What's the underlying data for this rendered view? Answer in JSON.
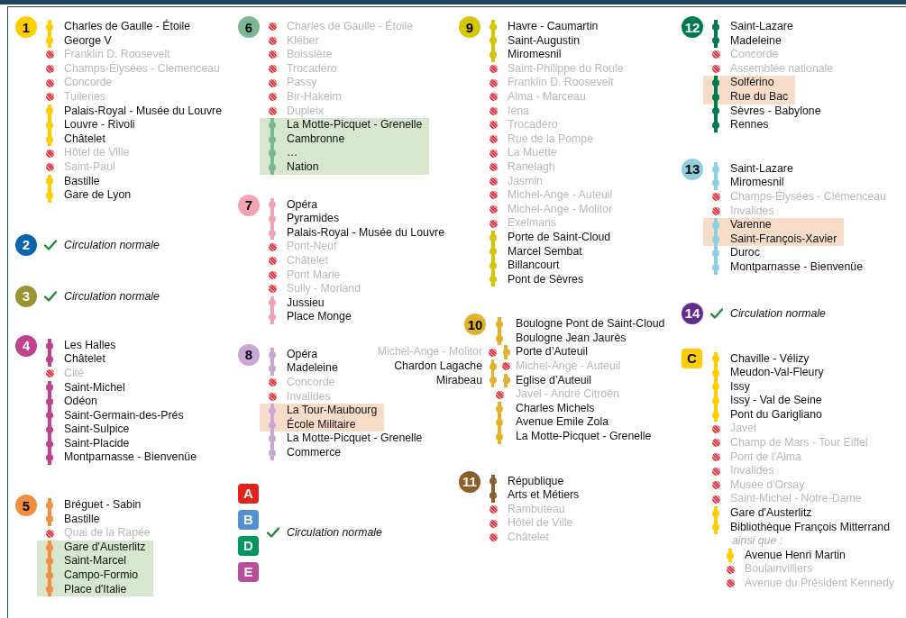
{
  "columns": [
    {
      "lines": [
        {
          "kind": "stations",
          "badge": {
            "label": "1",
            "color": "#ffcd00",
            "kind": "circle"
          },
          "stations": [
            {
              "name": "Charles de Gaulle - Étoile",
              "closed": false,
              "highlighted": false
            },
            {
              "name": "George V",
              "closed": false,
              "highlighted": false
            },
            {
              "name": "Franklin D. Roosevelt",
              "closed": true,
              "highlighted": false
            },
            {
              "name": "Champs-Élysées - Clemenceau",
              "closed": true,
              "highlighted": false
            },
            {
              "name": "Concorde",
              "closed": true,
              "highlighted": false
            },
            {
              "name": "Tuileries",
              "closed": true,
              "highlighted": false
            },
            {
              "name": "Palais-Royal - Musée du Louvre",
              "closed": false,
              "highlighted": false
            },
            {
              "name": "Louvre - Rivoli",
              "closed": false,
              "highlighted": false
            },
            {
              "name": "Châtelet",
              "closed": false,
              "highlighted": false
            },
            {
              "name": "Hôtel de Ville",
              "closed": true,
              "highlighted": false
            },
            {
              "name": "Saint-Paul",
              "closed": true,
              "highlighted": false
            },
            {
              "name": "Bastille",
              "closed": false,
              "highlighted": false
            },
            {
              "name": "Gare de Lyon",
              "closed": false,
              "highlighted": false
            }
          ]
        },
        {
          "kind": "status",
          "badge": {
            "label": "2",
            "color": "#0a64b0",
            "kind": "circle"
          },
          "status": "Circulation normale"
        },
        {
          "kind": "status",
          "badge": {
            "label": "3",
            "color": "#9a9331",
            "kind": "circle"
          },
          "status": "Circulation normale"
        },
        {
          "kind": "stations",
          "badge": {
            "label": "4",
            "color": "#c0428f",
            "kind": "circle"
          },
          "stations": [
            {
              "name": "Les Halles",
              "closed": false,
              "highlighted": false
            },
            {
              "name": "Châtelet",
              "closed": false,
              "highlighted": false
            },
            {
              "name": "Cité",
              "closed": true,
              "highlighted": false
            },
            {
              "name": "Saint-Michel",
              "closed": false,
              "highlighted": false
            },
            {
              "name": "Odéon",
              "closed": false,
              "highlighted": false
            },
            {
              "name": "Saint-Germain-des-Prés",
              "closed": false,
              "highlighted": false
            },
            {
              "name": "Saint-Sulpice",
              "closed": false,
              "highlighted": false
            },
            {
              "name": "Saint-Placide",
              "closed": false,
              "highlighted": false
            },
            {
              "name": "Montparnasse - Bienvenüe",
              "closed": false,
              "highlighted": false
            }
          ]
        },
        {
          "kind": "stations",
          "badge": {
            "label": "5",
            "color": "#f28e42",
            "kind": "circle"
          },
          "band": {
            "color": "#d6e7cd"
          },
          "stations": [
            {
              "name": "Bréguet - Sabin",
              "closed": false,
              "highlighted": false
            },
            {
              "name": "Bastille",
              "closed": false,
              "highlighted": false
            },
            {
              "name": "Quai de la Rapée",
              "closed": true,
              "highlighted": false
            },
            {
              "name": "Gare d'Austerlitz",
              "closed": false,
              "highlighted": true
            },
            {
              "name": "Saint-Marcel",
              "closed": false,
              "highlighted": true
            },
            {
              "name": "Campo-Formio",
              "closed": false,
              "highlighted": true
            },
            {
              "name": "Place d'Italie",
              "closed": false,
              "highlighted": true
            }
          ]
        }
      ]
    },
    {
      "lines": [
        {
          "kind": "stations",
          "badge": {
            "label": "6",
            "color": "#7ab893",
            "kind": "circle"
          },
          "band": {
            "color": "#d6e7cd"
          },
          "stations": [
            {
              "name": "Charles de Gaulle - Étoile",
              "closed": true,
              "highlighted": false
            },
            {
              "name": "Kléber",
              "closed": true,
              "highlighted": false
            },
            {
              "name": "Boissière",
              "closed": true,
              "highlighted": false
            },
            {
              "name": "Trocadéro",
              "closed": true,
              "highlighted": false
            },
            {
              "name": "Passy",
              "closed": true,
              "highlighted": false
            },
            {
              "name": "Bir-Hakeim",
              "closed": true,
              "highlighted": false
            },
            {
              "name": "Dupleix",
              "closed": true,
              "highlighted": false
            },
            {
              "name": "La Motte-Picquet - Grenelle",
              "closed": false,
              "highlighted": true
            },
            {
              "name": "Cambronne",
              "closed": false,
              "highlighted": true
            },
            {
              "name": "…",
              "closed": false,
              "highlighted": true
            },
            {
              "name": "Nation",
              "closed": false,
              "highlighted": true
            }
          ]
        },
        {
          "kind": "stations",
          "badge": {
            "label": "7",
            "color": "#f2a4b7",
            "kind": "circle"
          },
          "stations": [
            {
              "name": "Opéra",
              "closed": false,
              "highlighted": false
            },
            {
              "name": "Pyramides",
              "closed": false,
              "highlighted": false
            },
            {
              "name": "Palais-Royal - Musée du Louvre",
              "closed": false,
              "highlighted": false
            },
            {
              "name": "Pont-Neuf",
              "closed": true,
              "highlighted": false
            },
            {
              "name": "Châtelet",
              "closed": true,
              "highlighted": false
            },
            {
              "name": "Pont Marie",
              "closed": true,
              "highlighted": false
            },
            {
              "name": "Sully - Morland",
              "closed": true,
              "highlighted": false
            },
            {
              "name": "Jussieu",
              "closed": false,
              "highlighted": false
            },
            {
              "name": "Place Monge",
              "closed": false,
              "highlighted": false
            }
          ]
        },
        {
          "kind": "stations",
          "badge": {
            "label": "8",
            "color": "#c8a6d5",
            "kind": "circle"
          },
          "band": {
            "color": "#f7dcc9"
          },
          "stations": [
            {
              "name": "Opéra",
              "closed": false,
              "highlighted": false
            },
            {
              "name": "Madeleine",
              "closed": false,
              "highlighted": false
            },
            {
              "name": "Concorde",
              "closed": true,
              "highlighted": false
            },
            {
              "name": "Invalides",
              "closed": true,
              "highlighted": false
            },
            {
              "name": "La Tour-Maubourg",
              "closed": false,
              "highlighted": true
            },
            {
              "name": "École Militaire",
              "closed": false,
              "highlighted": true
            },
            {
              "name": "La Motte-Picquet - Grenelle",
              "closed": false,
              "highlighted": false
            },
            {
              "name": "Commerce",
              "closed": false,
              "highlighted": false
            }
          ]
        },
        {
          "kind": "group",
          "badges": [
            {
              "label": "A",
              "color": "#e2231a",
              "kind": "square"
            },
            {
              "label": "B",
              "color": "#5291ce",
              "kind": "square"
            },
            {
              "label": "D",
              "color": "#00965e",
              "kind": "square"
            },
            {
              "label": "E",
              "color": "#b94e9a",
              "kind": "square"
            }
          ],
          "status": "Circulation normale"
        }
      ]
    },
    {
      "lines": [
        {
          "kind": "stations",
          "badge": {
            "label": "9",
            "color": "#d4c600",
            "kind": "circle"
          },
          "stations": [
            {
              "name": "Havre - Caumartin",
              "closed": false,
              "highlighted": false
            },
            {
              "name": "Saint-Augustin",
              "closed": false,
              "highlighted": false
            },
            {
              "name": "Miromesnil",
              "closed": false,
              "highlighted": false
            },
            {
              "name": "Saint-Philippe du Roule",
              "closed": true,
              "highlighted": false
            },
            {
              "name": "Franklin D. Roosevelt",
              "closed": true,
              "highlighted": false
            },
            {
              "name": "Alma - Marceau",
              "closed": true,
              "highlighted": false
            },
            {
              "name": "Iéna",
              "closed": true,
              "highlighted": false
            },
            {
              "name": "Trocadéro",
              "closed": true,
              "highlighted": false
            },
            {
              "name": "Rue de la Pompe",
              "closed": true,
              "highlighted": false
            },
            {
              "name": "La Muette",
              "closed": true,
              "highlighted": false
            },
            {
              "name": "Ranelagh",
              "closed": true,
              "highlighted": false
            },
            {
              "name": "Jasmin",
              "closed": true,
              "highlighted": false
            },
            {
              "name": "Michel-Ange - Auteuil",
              "closed": true,
              "highlighted": false
            },
            {
              "name": "Michel-Ange - Molitor",
              "closed": true,
              "highlighted": false
            },
            {
              "name": "Exelmans",
              "closed": true,
              "highlighted": false
            },
            {
              "name": "Porte de Saint-Cloud",
              "closed": false,
              "highlighted": false
            },
            {
              "name": "Marcel Sembat",
              "closed": false,
              "highlighted": false
            },
            {
              "name": "Billancourt",
              "closed": false,
              "highlighted": false
            },
            {
              "name": "Pont de Sèvres",
              "closed": false,
              "highlighted": false
            }
          ]
        },
        {
          "kind": "branched",
          "badge": {
            "label": "10",
            "color": "#e2b22d",
            "kind": "circle"
          },
          "stations": [
            {
              "name": "Boulogne Pont de Saint-Cloud",
              "closed": false
            },
            {
              "name": "Boulogne Jean Jaurès",
              "closed": false
            }
          ],
          "branch_left": [
            {
              "name": "Michel-Ange - Molitor",
              "closed": true
            },
            {
              "name": "Chardon Lagache",
              "closed": false
            },
            {
              "name": "Mirabeau",
              "closed": false
            }
          ],
          "branch_right": [
            {
              "name": "Porte d’Auteuil",
              "closed": false
            },
            {
              "name": "Michel-Ange - Auteuil",
              "closed": true
            },
            {
              "name": "Eglise d’Auteuil",
              "closed": false
            }
          ],
          "after": [
            {
              "name": "Javel - André Citroën",
              "closed": true
            },
            {
              "name": "Charles Michels",
              "closed": false
            },
            {
              "name": "Avenue Emile Zola",
              "closed": false
            },
            {
              "name": "La Motte-Picquet - Grenelle",
              "closed": false
            }
          ]
        },
        {
          "kind": "stations",
          "badge": {
            "label": "11",
            "color": "#8b5e2a",
            "kind": "circle"
          },
          "stations": [
            {
              "name": "République",
              "closed": false,
              "highlighted": false
            },
            {
              "name": "Arts et Métiers",
              "closed": false,
              "highlighted": false
            },
            {
              "name": "Rambuteau",
              "closed": true,
              "highlighted": false
            },
            {
              "name": "Hôtel de Ville",
              "closed": true,
              "highlighted": false
            },
            {
              "name": "Châtelet",
              "closed": true,
              "highlighted": false
            }
          ]
        }
      ]
    },
    {
      "lines": [
        {
          "kind": "stations",
          "badge": {
            "label": "12",
            "color": "#007a4d",
            "kind": "circle"
          },
          "band": {
            "color": "#f7dcc9"
          },
          "stations": [
            {
              "name": "Saint-Lazare",
              "closed": false,
              "highlighted": false
            },
            {
              "name": "Madeleine",
              "closed": false,
              "highlighted": false
            },
            {
              "name": "Concorde",
              "closed": true,
              "highlighted": false
            },
            {
              "name": "Assemblée nationale",
              "closed": true,
              "highlighted": false
            },
            {
              "name": "Solférino",
              "closed": false,
              "highlighted": true
            },
            {
              "name": "Rue du Bac",
              "closed": false,
              "highlighted": true
            },
            {
              "name": "Sèvres - Babylone",
              "closed": false,
              "highlighted": false
            },
            {
              "name": "Rennes",
              "closed": false,
              "highlighted": false
            }
          ]
        },
        {
          "kind": "stations",
          "badge": {
            "label": "13",
            "color": "#8fd0e0",
            "kind": "circle"
          },
          "band": {
            "color": "#f7dcc9"
          },
          "stations": [
            {
              "name": "Saint-Lazare",
              "closed": false,
              "highlighted": false
            },
            {
              "name": "Miromesnil",
              "closed": false,
              "highlighted": false
            },
            {
              "name": "Champs-Élysées - Clémenceau",
              "closed": true,
              "highlighted": false
            },
            {
              "name": "Invalides",
              "closed": true,
              "highlighted": false
            },
            {
              "name": "Varenne",
              "closed": false,
              "highlighted": true
            },
            {
              "name": "Saint-François-Xavier",
              "closed": false,
              "highlighted": true
            },
            {
              "name": "Duroc",
              "closed": false,
              "highlighted": false
            },
            {
              "name": "Montparnasse - Bienvenüe",
              "closed": false,
              "highlighted": false
            }
          ]
        },
        {
          "kind": "status",
          "badge": {
            "label": "14",
            "color": "#662d91",
            "kind": "circle"
          },
          "status": "Circulation normale"
        },
        {
          "kind": "stations",
          "badge": {
            "label": "C",
            "color": "#ffcd00",
            "kind": "square"
          },
          "stations": [
            {
              "name": "Chaville - Vélizy",
              "closed": false,
              "highlighted": false
            },
            {
              "name": "Meudon-Val-Fleury",
              "closed": false,
              "highlighted": false
            },
            {
              "name": "Issy",
              "closed": false,
              "highlighted": false
            },
            {
              "name": "Issy - Val de Seine",
              "closed": false,
              "highlighted": false
            },
            {
              "name": "Pont du Garigliano",
              "closed": false,
              "highlighted": false
            },
            {
              "name": "Javel",
              "closed": true,
              "highlighted": false
            },
            {
              "name": "Champ de Mars - Tour Eiffel",
              "closed": true,
              "highlighted": false
            },
            {
              "name": "Pont de l'Alma",
              "closed": true,
              "highlighted": false
            },
            {
              "name": "Invalides",
              "closed": true,
              "highlighted": false
            },
            {
              "name": "Musée d'Orsay",
              "closed": true,
              "highlighted": false
            },
            {
              "name": "Saint-Michel - Notre-Dame",
              "closed": true,
              "highlighted": false
            },
            {
              "name": "Gare d'Austerlitz",
              "closed": false,
              "highlighted": false
            },
            {
              "name": "Bibliothèque François Mitterrand",
              "closed": false,
              "highlighted": false
            }
          ],
          "also_label": "ainsi que :",
          "also": [
            {
              "name": "Avenue Henri Martin",
              "closed": false
            },
            {
              "name": "Boulainvilliers",
              "closed": true
            },
            {
              "name": "Avenue du Président Kennedy",
              "closed": true
            }
          ]
        }
      ]
    }
  ]
}
